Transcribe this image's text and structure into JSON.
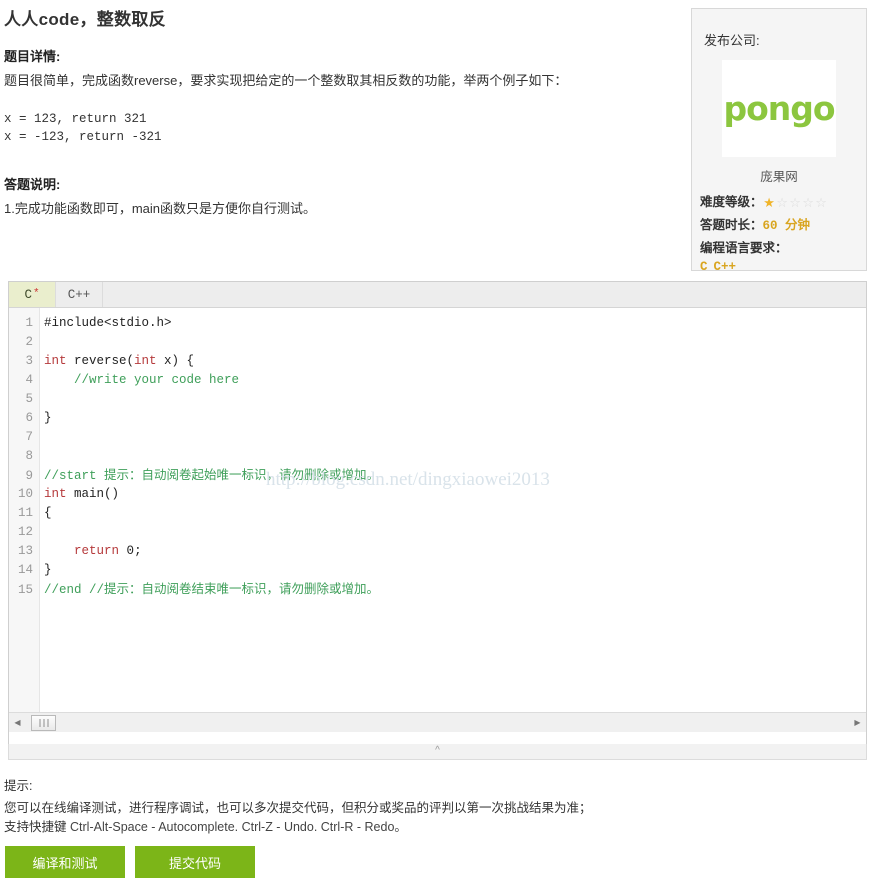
{
  "page": {
    "title": "人人code，整数取反",
    "watermark": "http://blog.csdn.net/dingxiaowei2013"
  },
  "description": {
    "detail_heading": "题目详情:",
    "detail_text": "题目很简单，完成函数reverse，要求实现把给定的一个整数取其相反数的功能，举两个例子如下：",
    "example_1": "x = 123, return 321",
    "example_2": "x = -123, return -321",
    "answer_heading": "答题说明:",
    "answer_text": "1.完成功能函数即可，main函数只是方便你自行测试。"
  },
  "company_panel": {
    "label": "发布公司:",
    "logo_text": "pongo",
    "company_name": "庞果网",
    "difficulty_label": "难度等级：",
    "difficulty_filled": 1,
    "difficulty_total": 5,
    "duration_label": "答题时长：",
    "duration_value": "60  分钟",
    "language_label": "编程语言要求：",
    "languages": [
      "C",
      "C++"
    ],
    "star_on_color": "#f0b429",
    "star_off_color": "#dcdcdc",
    "accent_color": "#d9a520",
    "logo_color": "#8cc63f"
  },
  "editor": {
    "tabs": [
      {
        "label": "C",
        "modified_mark": "*",
        "active": true
      },
      {
        "label": "C++",
        "modified_mark": "",
        "active": false
      }
    ],
    "lines": [
      {
        "n": "1",
        "tokens": [
          {
            "t": "plain",
            "v": "#include<stdio.h>"
          }
        ]
      },
      {
        "n": "2",
        "tokens": []
      },
      {
        "n": "3",
        "tokens": [
          {
            "t": "kw",
            "v": "int"
          },
          {
            "t": "plain",
            "v": " reverse("
          },
          {
            "t": "kw",
            "v": "int"
          },
          {
            "t": "plain",
            "v": " x) {"
          }
        ]
      },
      {
        "n": "4",
        "tokens": [
          {
            "t": "com",
            "v": "    //write your code here"
          }
        ]
      },
      {
        "n": "5",
        "tokens": []
      },
      {
        "n": "6",
        "tokens": [
          {
            "t": "plain",
            "v": "}"
          }
        ]
      },
      {
        "n": "7",
        "tokens": []
      },
      {
        "n": "8",
        "tokens": []
      },
      {
        "n": "9",
        "tokens": [
          {
            "t": "com",
            "v": "//start "
          },
          {
            "t": "com-cn",
            "v": "提示：自动阅卷起始唯一标识，请勿删除或增加。"
          }
        ]
      },
      {
        "n": "10",
        "tokens": [
          {
            "t": "kw",
            "v": "int"
          },
          {
            "t": "plain",
            "v": " main()"
          }
        ]
      },
      {
        "n": "11",
        "tokens": [
          {
            "t": "plain",
            "v": "{"
          }
        ]
      },
      {
        "n": "12",
        "tokens": []
      },
      {
        "n": "13",
        "tokens": [
          {
            "t": "plain",
            "v": "    "
          },
          {
            "t": "kw",
            "v": "return"
          },
          {
            "t": "plain",
            "v": " "
          },
          {
            "t": "num",
            "v": "0"
          },
          {
            "t": "plain",
            "v": ";"
          }
        ]
      },
      {
        "n": "14",
        "tokens": [
          {
            "t": "plain",
            "v": "}"
          }
        ]
      },
      {
        "n": "15",
        "tokens": [
          {
            "t": "com",
            "v": "//end //"
          },
          {
            "t": "com-cn",
            "v": "提示：自动阅卷结束唯一标识，请勿删除或增加。"
          }
        ]
      }
    ]
  },
  "hints": {
    "title": "提示:",
    "line_1": "您可以在线编译测试，进行程序调试，也可以多次提交代码，但积分或奖品的评判以第一次挑战结果为准；",
    "line_2_prefix": "支持快捷键",
    "line_2_keys": "Ctrl-Alt-Space - Autocomplete. Ctrl-Z - Undo. Ctrl-R - Redo。"
  },
  "actions": {
    "compile_label": "编译和测试",
    "submit_label": "提交代码",
    "button_color": "#7cb518"
  }
}
